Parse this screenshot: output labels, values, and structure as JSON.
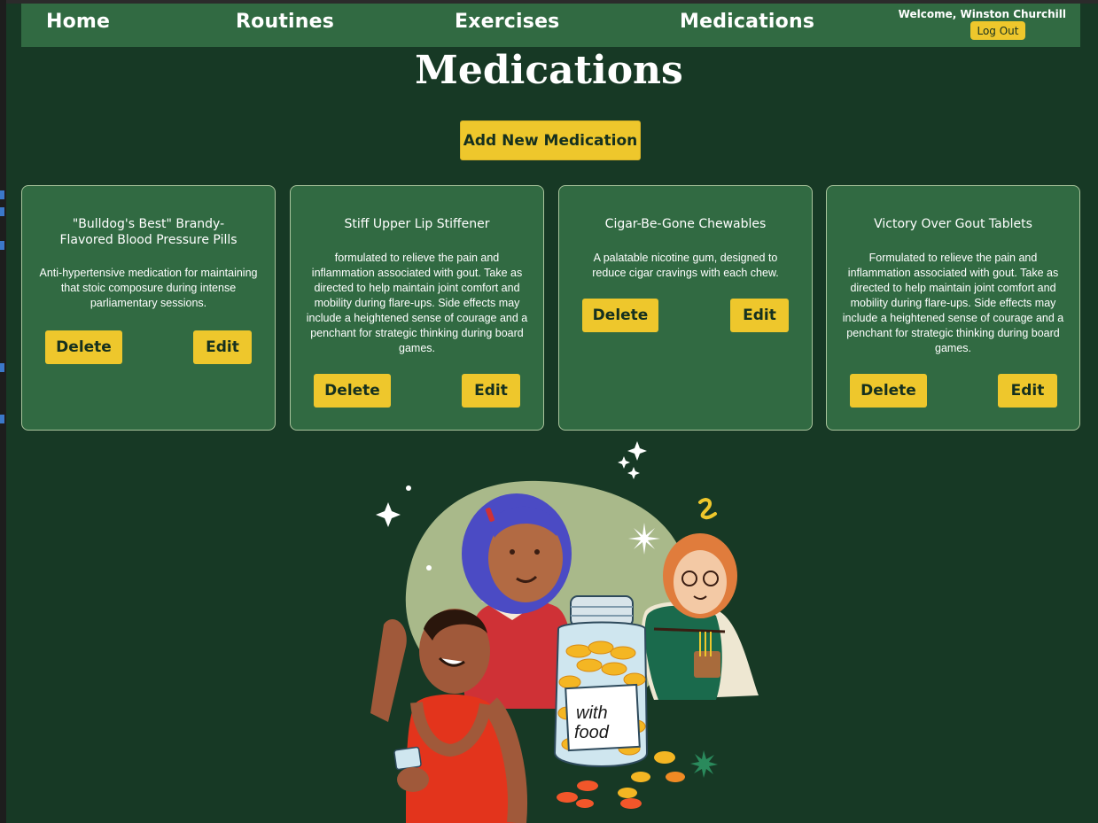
{
  "nav": {
    "links": [
      "Home",
      "Routines",
      "Exercises",
      "Medications"
    ],
    "welcome": "Welcome, Winston Churchill",
    "logout_label": "Log Out"
  },
  "page": {
    "title": "Medications",
    "add_button": "Add New Medication"
  },
  "medications": [
    {
      "name": "\"Bulldog's Best\" Brandy-Flavored Blood Pressure Pills",
      "description": "Anti-hypertensive medication for maintaining that stoic composure during intense parliamentary sessions.",
      "delete_label": "Delete",
      "edit_label": "Edit"
    },
    {
      "name": "Stiff Upper Lip Stiffener",
      "description": "formulated to relieve the pain and inflammation associated with gout. Take as directed to help maintain joint comfort and mobility during flare-ups. Side effects may include a heightened sense of courage and a penchant for strategic thinking during board games.",
      "delete_label": "Delete",
      "edit_label": "Edit"
    },
    {
      "name": "Cigar-Be-Gone Chewables",
      "description": "A palatable nicotine gum, designed to reduce cigar cravings with each chew.",
      "delete_label": "Delete",
      "edit_label": "Edit"
    },
    {
      "name": "Victory Over Gout Tablets",
      "description": "Formulated to relieve the pain and inflammation associated with gout. Take as directed to help maintain joint comfort and mobility during flare-ups. Side effects may include a heightened sense of courage and a penchant for strategic thinking during board games.",
      "delete_label": "Delete",
      "edit_label": "Edit"
    }
  ],
  "illustration": {
    "jar_label_line1": "with",
    "jar_label_line2": "food"
  },
  "colors": {
    "background": "#173925",
    "nav": "#316a42",
    "card": "#316a42",
    "accent": "#eec72c"
  }
}
